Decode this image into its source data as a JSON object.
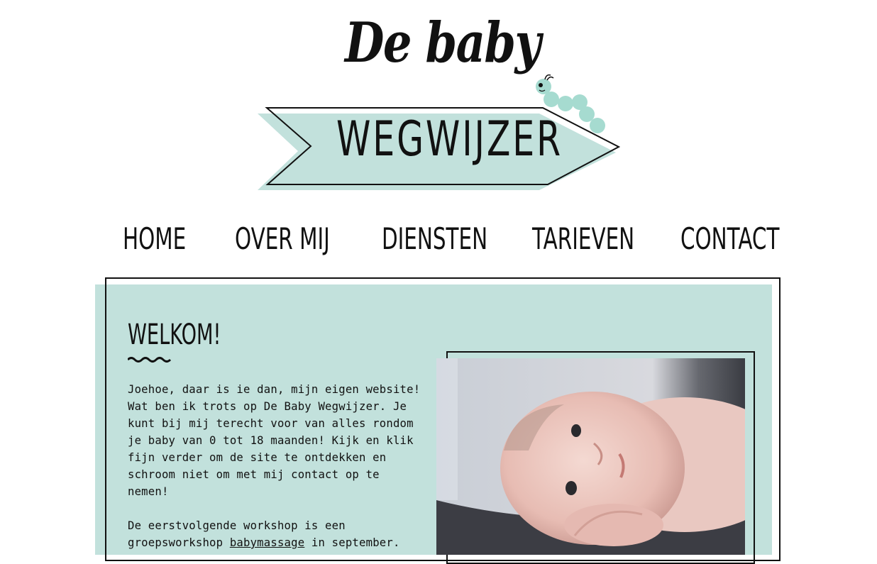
{
  "logo": {
    "title": "De baby",
    "word": "WEGWIJZER",
    "colors": {
      "mint": "#c2e1dc",
      "caterpillar": "#a6dbd0",
      "ink": "#111111"
    }
  },
  "nav": {
    "items": [
      {
        "label": "HOME"
      },
      {
        "label": "OVER MIJ"
      },
      {
        "label": "DIENSTEN"
      },
      {
        "label": "TARIEVEN"
      },
      {
        "label": "CONTACT"
      }
    ]
  },
  "main": {
    "heading": "WELKOM!",
    "intro": "Joehoe, daar is ie dan, mijn eigen website! Wat ben ik trots op De Baby Wegwijzer. Je kunt bij mij terecht voor van alles rondom je baby van 0 tot 18 maanden! Kijk en klik fijn verder om de site te ontdekken en schroom niet om met mij contact op te nemen!",
    "workshop_before": "De eerstvolgende workshop is een groepsworkshop ",
    "workshop_link": "babymassage",
    "workshop_after": " in september.",
    "photo_icon": "baby-photo"
  }
}
